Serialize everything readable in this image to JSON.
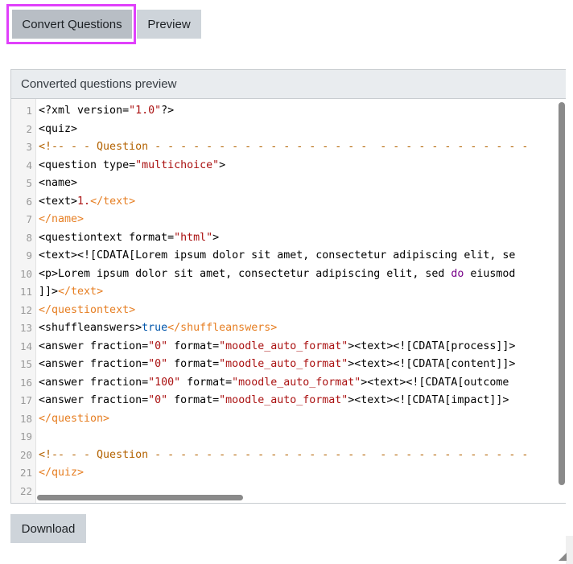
{
  "toolbar": {
    "convert_label": "Convert Questions",
    "preview_label": "Preview"
  },
  "card": {
    "title": "Converted questions preview"
  },
  "code": {
    "line_numbers": [
      "1",
      "2",
      "3",
      "4",
      "5",
      "6",
      "7",
      "8",
      "9",
      "10",
      "11",
      "12",
      "13",
      "14",
      "15",
      "16",
      "17",
      "18",
      "19",
      "20",
      "21",
      "22"
    ],
    "lines": [
      [
        {
          "t": "<?xml version=",
          "c": ""
        },
        {
          "t": "\"1.0\"",
          "c": "v"
        },
        {
          "t": "?>",
          "c": ""
        }
      ],
      [
        {
          "t": "<quiz>",
          "c": ""
        }
      ],
      [
        {
          "t": "<!-- - - Question - - - - - - - - - - - - - - - - -  - - - - - - - - - - - -",
          "c": "c"
        }
      ],
      [
        {
          "t": "<question type=",
          "c": ""
        },
        {
          "t": "\"multichoice\"",
          "c": "v"
        },
        {
          "t": ">",
          "c": ""
        }
      ],
      [
        {
          "t": "<name>",
          "c": ""
        }
      ],
      [
        {
          "t": "<text>",
          "c": ""
        },
        {
          "t": "1.",
          "c": "v"
        },
        {
          "t": "</text>",
          "c": "t"
        }
      ],
      [
        {
          "t": "</name>",
          "c": "t"
        }
      ],
      [
        {
          "t": "<questiontext format=",
          "c": ""
        },
        {
          "t": "\"html\"",
          "c": "v"
        },
        {
          "t": ">",
          "c": ""
        }
      ],
      [
        {
          "t": "<text><![CDATA[Lorem ipsum dolor sit amet, consectetur adipiscing elit, se",
          "c": ""
        }
      ],
      [
        {
          "t": "<p>Lorem ipsum dolor sit amet, consectetur adipiscing elit, sed ",
          "c": ""
        },
        {
          "t": "do",
          "c": "k"
        },
        {
          "t": " eiusmod",
          "c": ""
        }
      ],
      [
        {
          "t": "]]>",
          "c": ""
        },
        {
          "t": "</text>",
          "c": "t"
        }
      ],
      [
        {
          "t": "</questiontext>",
          "c": "t"
        }
      ],
      [
        {
          "t": "<shuffleanswers>",
          "c": ""
        },
        {
          "t": "true",
          "c": "b"
        },
        {
          "t": "</shuffleanswers>",
          "c": "t"
        }
      ],
      [
        {
          "t": "<answer fraction=",
          "c": ""
        },
        {
          "t": "\"0\"",
          "c": "v"
        },
        {
          "t": " format=",
          "c": ""
        },
        {
          "t": "\"moodle_auto_format\"",
          "c": "v"
        },
        {
          "t": "><text><![CDATA[process]]>",
          "c": ""
        }
      ],
      [
        {
          "t": "<answer fraction=",
          "c": ""
        },
        {
          "t": "\"0\"",
          "c": "v"
        },
        {
          "t": " format=",
          "c": ""
        },
        {
          "t": "\"moodle_auto_format\"",
          "c": "v"
        },
        {
          "t": "><text><![CDATA[content]]>",
          "c": ""
        }
      ],
      [
        {
          "t": "<answer fraction=",
          "c": ""
        },
        {
          "t": "\"100\"",
          "c": "v"
        },
        {
          "t": " format=",
          "c": ""
        },
        {
          "t": "\"moodle_auto_format\"",
          "c": "v"
        },
        {
          "t": "><text><![CDATA[outcome",
          "c": ""
        }
      ],
      [
        {
          "t": "<answer fraction=",
          "c": ""
        },
        {
          "t": "\"0\"",
          "c": "v"
        },
        {
          "t": " format=",
          "c": ""
        },
        {
          "t": "\"moodle_auto_format\"",
          "c": "v"
        },
        {
          "t": "><text><![CDATA[impact]]>",
          "c": ""
        }
      ],
      [
        {
          "t": "</question>",
          "c": "t"
        }
      ],
      [],
      [
        {
          "t": "<!-- - - Question - - - - - - - - - - - - - - - - -  - - - - - - - - - - - -",
          "c": "c"
        }
      ],
      [
        {
          "t": "</quiz>",
          "c": "t"
        }
      ],
      []
    ]
  },
  "footer": {
    "download_label": "Download"
  },
  "colors": {
    "highlight_border": "#e040fb",
    "button_bg": "#ced4da",
    "header_bg": "#e9ecef",
    "attr_value": "#aa1111",
    "closing_tag": "#e67e22",
    "comment": "#b36200",
    "keyword": "#770088",
    "boolean": "#0055aa"
  },
  "icons": {
    "resize": "resize-grip-icon"
  }
}
